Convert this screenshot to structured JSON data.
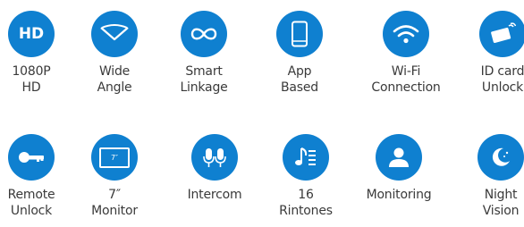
{
  "accent_color": "#0f80d0",
  "text_color": "#3a3a3a",
  "rows": [
    {
      "items": [
        {
          "icon": "hd-icon",
          "label": "1080P\nHD",
          "icon_text": "HD"
        },
        {
          "icon": "wide-angle-icon",
          "label": "Wide\nAngle"
        },
        {
          "icon": "infinity-link-icon",
          "label": "Smart\nLinkage"
        },
        {
          "icon": "smartphone-icon",
          "label": "App\nBased"
        },
        {
          "icon": "wifi-icon",
          "label": "Wi-Fi\nConnection"
        },
        {
          "icon": "id-card-icon",
          "label": "ID card\nUnlock"
        }
      ]
    },
    {
      "items": [
        {
          "icon": "key-icon",
          "label": "Remote\nUnlock"
        },
        {
          "icon": "monitor-icon",
          "label": "7″\nMonitor",
          "icon_text": "7″"
        },
        {
          "icon": "microphone-icon",
          "label": "Intercom"
        },
        {
          "icon": "music-note-icon",
          "label": "16\nRintones"
        },
        {
          "icon": "user-icon",
          "label": "Monitoring"
        },
        {
          "icon": "moon-icon",
          "label": "Night\nVision"
        }
      ]
    }
  ]
}
